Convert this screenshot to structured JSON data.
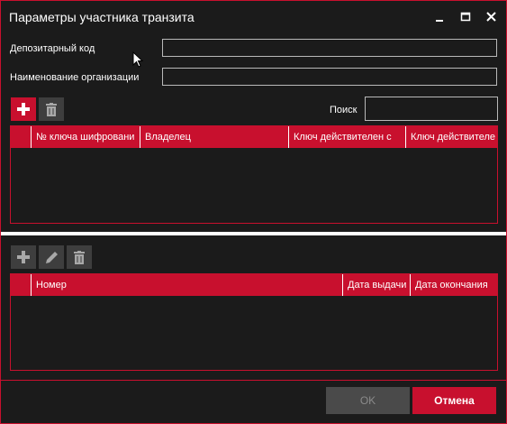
{
  "window": {
    "title": "Параметры участника транзита"
  },
  "form": {
    "depository_code_label": "Депозитарный код",
    "depository_code_value": "",
    "org_name_label": "Наименование организации",
    "org_name_value": "",
    "search_label": "Поиск",
    "search_value": ""
  },
  "keys_table": {
    "columns": [
      "№ ключа шифровани",
      "Владелец",
      "Ключ действителен с",
      "Ключ действителе"
    ],
    "rows": []
  },
  "docs_table": {
    "columns": [
      "Номер",
      "Дата выдачи",
      "Дата окончания"
    ],
    "rows": []
  },
  "footer": {
    "ok_label": "OK",
    "cancel_label": "Отмена"
  },
  "colors": {
    "accent": "#c8102e",
    "background": "#1b1b1b",
    "toolbar_button": "#3e3e3e",
    "disabled_button": "#4a4a4a"
  },
  "icons": [
    "minimize-icon",
    "maximize-icon",
    "close-icon",
    "plus-icon",
    "trash-icon",
    "pencil-icon",
    "mouse-pointer-icon"
  ]
}
